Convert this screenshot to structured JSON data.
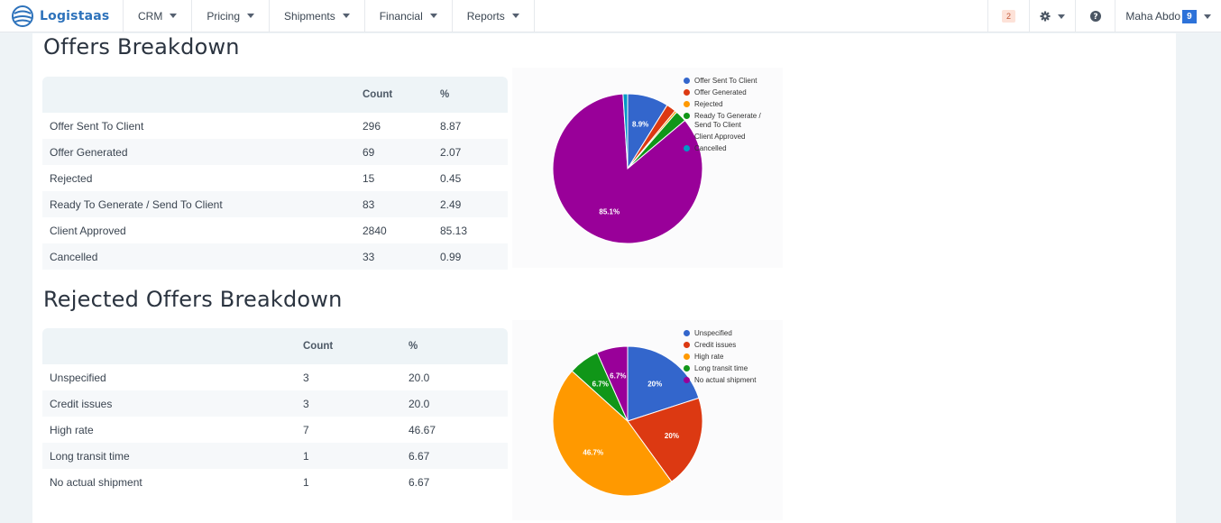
{
  "brand": {
    "name": "Logistaas"
  },
  "nav": {
    "items": [
      {
        "label": "CRM"
      },
      {
        "label": "Pricing"
      },
      {
        "label": "Shipments"
      },
      {
        "label": "Financial"
      },
      {
        "label": "Reports"
      }
    ],
    "notifications": "2",
    "user": {
      "name": "Maha Abdo",
      "count": "9"
    }
  },
  "offers": {
    "title": "Offers Breakdown",
    "headers": {
      "count": "Count",
      "percent": "%"
    },
    "rows": [
      {
        "label": "Offer Sent To Client",
        "count": "296",
        "percent": "8.87"
      },
      {
        "label": "Offer Generated",
        "count": "69",
        "percent": "2.07"
      },
      {
        "label": "Rejected",
        "count": "15",
        "percent": "0.45"
      },
      {
        "label": "Ready To Generate / Send To Client",
        "count": "83",
        "percent": "2.49"
      },
      {
        "label": "Client Approved",
        "count": "2840",
        "percent": "85.13"
      },
      {
        "label": "Cancelled",
        "count": "33",
        "percent": "0.99"
      }
    ]
  },
  "rejected": {
    "title": "Rejected Offers Breakdown",
    "headers": {
      "count": "Count",
      "percent": "%"
    },
    "rows": [
      {
        "label": "Unspecified",
        "count": "3",
        "percent": "20.0"
      },
      {
        "label": "Credit issues",
        "count": "3",
        "percent": "20.0"
      },
      {
        "label": "High rate",
        "count": "7",
        "percent": "46.67"
      },
      {
        "label": "Long transit time",
        "count": "1",
        "percent": "6.67"
      },
      {
        "label": "No actual shipment",
        "count": "1",
        "percent": "6.67"
      }
    ]
  },
  "chart_data": [
    {
      "type": "pie",
      "categories": [
        "Offer Sent To Client",
        "Offer Generated",
        "Rejected",
        "Ready To Generate / Send To Client",
        "Client Approved",
        "Cancelled"
      ],
      "values": [
        296,
        69,
        15,
        83,
        2840,
        33
      ],
      "colors": [
        "#3366cc",
        "#dc3912",
        "#ff9900",
        "#109618",
        "#990099",
        "#0099c6"
      ],
      "slice_labels": [
        "8.9%",
        "",
        "",
        "",
        "85.1%",
        ""
      ],
      "legend": "right"
    },
    {
      "type": "pie",
      "categories": [
        "Unspecified",
        "Credit issues",
        "High rate",
        "Long transit time",
        "No actual shipment"
      ],
      "values": [
        3,
        3,
        7,
        1,
        1
      ],
      "colors": [
        "#3366cc",
        "#dc3912",
        "#ff9900",
        "#109618",
        "#990099"
      ],
      "slice_labels": [
        "20%",
        "20%",
        "46.7%",
        "6.7%",
        "6.7%"
      ],
      "legend": "right"
    }
  ]
}
